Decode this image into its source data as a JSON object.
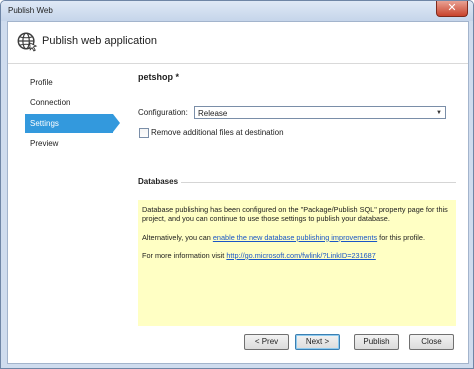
{
  "window": {
    "title": "Publish Web",
    "close_label": "✕"
  },
  "header": {
    "title": "Publish web application",
    "icon": "globe-publish-icon"
  },
  "nav": {
    "items": [
      {
        "label": "Profile",
        "active": false
      },
      {
        "label": "Connection",
        "active": false
      },
      {
        "label": "Settings",
        "active": true
      },
      {
        "label": "Preview",
        "active": false
      }
    ]
  },
  "settings": {
    "profile_name": "petshop *",
    "configuration_label": "Configuration:",
    "configuration_value": "Release",
    "remove_files_label": "Remove additional files at destination",
    "remove_files_checked": false
  },
  "databases": {
    "section_title": "Databases",
    "info_para1": "Database publishing has been configured on the \"Package/Publish SQL\" property page for this project, and you can continue to use those settings to publish your database.",
    "info_para2_prefix": "Alternatively, you can ",
    "info_para2_link": "enable the new database publishing improvements",
    "info_para2_suffix": " for this profile.",
    "info_para3_prefix": "For more information visit ",
    "info_para3_link": "http://go.microsoft.com/fwlink/?LinkID=231687"
  },
  "buttons": {
    "prev": "< Prev",
    "next": "Next >",
    "publish": "Publish",
    "close": "Close"
  },
  "colors": {
    "nav_active": "#3399dd",
    "info_background": "#ffffc4",
    "link": "#1a56c6"
  }
}
